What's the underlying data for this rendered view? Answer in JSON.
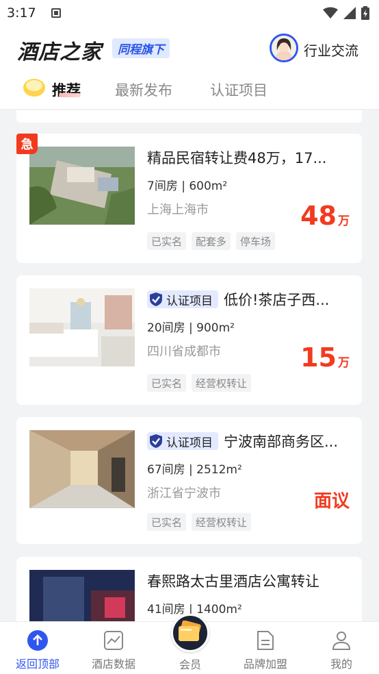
{
  "status_bar": {
    "time": "3:17"
  },
  "header": {
    "logo": "酒店之家",
    "badge": "同程旗下",
    "industry": "行业交流"
  },
  "tabs": [
    {
      "label": "推荐"
    },
    {
      "label": "最新发布"
    },
    {
      "label": "认证项目"
    }
  ],
  "listings": [
    {
      "title": "精品民宿转让费48万，17...",
      "spec": "7间房 | 600m²",
      "location": "上海上海市",
      "price": "48",
      "unit": "万",
      "urgent": "急",
      "tags": [
        "已实名",
        "配套多",
        "停车场"
      ]
    },
    {
      "verified": "认证项目",
      "title": "低价!茶店子西...",
      "spec": "20间房 | 900m²",
      "location": "四川省成都市",
      "price": "15",
      "unit": "万",
      "tags": [
        "已实名",
        "经营权转让"
      ]
    },
    {
      "verified": "认证项目",
      "title": "宁波南部商务区...",
      "spec": "67间房 | 2512m²",
      "location": "浙江省宁波市",
      "price": "面议",
      "tags": [
        "已实名",
        "经营权转让"
      ]
    },
    {
      "title": "春熙路太古里酒店公寓转让",
      "spec": "41间房 | 1400m²"
    }
  ],
  "bottom_nav": [
    {
      "label": "返回顶部"
    },
    {
      "label": "酒店数据"
    },
    {
      "label": "会员"
    },
    {
      "label": "品牌加盟"
    },
    {
      "label": "我的"
    }
  ],
  "colors": {
    "accent": "#2f56ee",
    "price": "#f23a1f",
    "verify_bg": "#e3eaff"
  }
}
